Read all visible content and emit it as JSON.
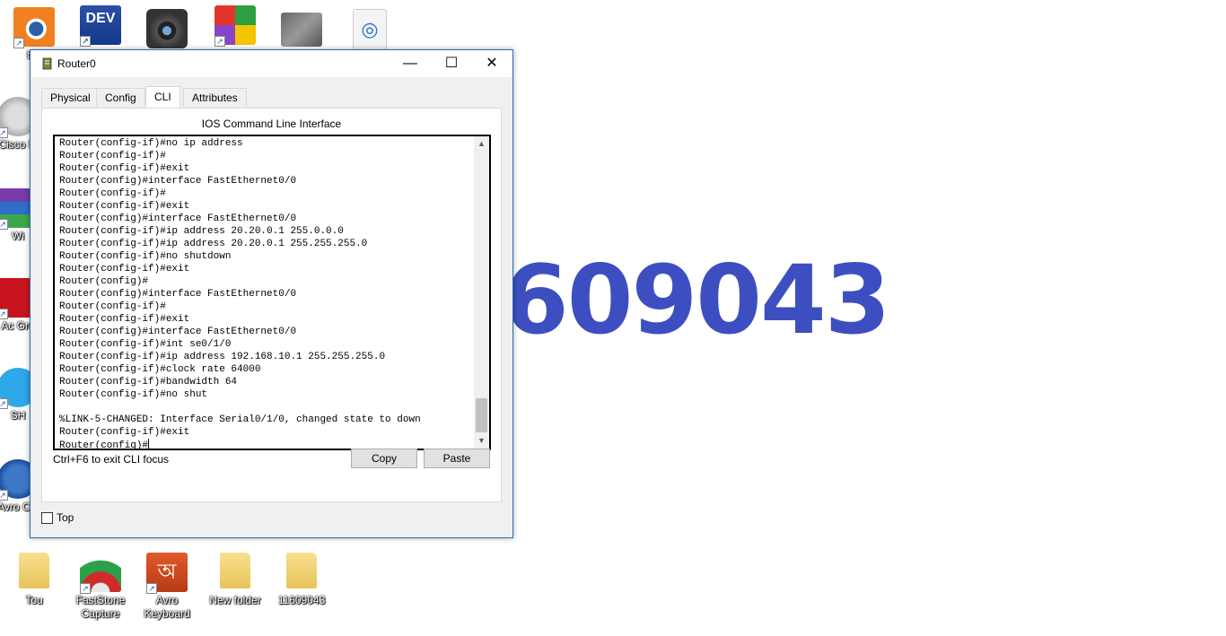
{
  "desktop": {
    "wallpaper_text": "609043",
    "icons": [
      {
        "label": "ble",
        "icon": "blender-icon"
      },
      {
        "label": "",
        "icon": "dev-cpp-icon",
        "badge": "DEV"
      },
      {
        "label": "",
        "icon": "camera-icon"
      },
      {
        "label": "",
        "icon": "windows-app-icon"
      },
      {
        "label": "",
        "icon": "photo-icon"
      },
      {
        "label": "",
        "icon": "document-icon"
      },
      {
        "label": "Cisco In",
        "icon": "cisco-icon"
      },
      {
        "label": "Wi",
        "icon": "winrar-icon"
      },
      {
        "label": "Ac Gre",
        "icon": "adobe-icon"
      },
      {
        "label": "SH",
        "icon": "shareit-icon"
      },
      {
        "label": "Avro Chi",
        "icon": "avro-icon"
      },
      {
        "label": "Tou",
        "icon": "folder-user-icon"
      },
      {
        "label": "FastStone Capture",
        "icon": "faststone-icon"
      },
      {
        "label": "Avro Keyboard",
        "icon": "avro-keyboard-icon",
        "badge": "অ"
      },
      {
        "label": "New folder",
        "icon": "folder-icon"
      },
      {
        "label": "11609043",
        "icon": "folder-icon"
      }
    ]
  },
  "window": {
    "title": "Router0",
    "controls": {
      "minimize": "—",
      "maximize": "☐",
      "close": "✕"
    },
    "tabs": [
      {
        "label": "Physical",
        "active": false
      },
      {
        "label": "Config",
        "active": false
      },
      {
        "label": "CLI",
        "active": true
      },
      {
        "label": "Attributes",
        "active": false
      }
    ],
    "panel_title": "IOS Command Line Interface",
    "terminal_lines": [
      "Router(config-if)#no ip address",
      "Router(config-if)#",
      "Router(config-if)#exit",
      "Router(config)#interface FastEthernet0/0",
      "Router(config-if)#",
      "Router(config-if)#exit",
      "Router(config)#interface FastEthernet0/0",
      "Router(config-if)#ip address 20.20.0.1 255.0.0.0",
      "Router(config-if)#ip address 20.20.0.1 255.255.255.0",
      "Router(config-if)#no shutdown",
      "Router(config-if)#exit",
      "Router(config)#",
      "Router(config)#interface FastEthernet0/0",
      "Router(config-if)#",
      "Router(config-if)#exit",
      "Router(config)#interface FastEthernet0/0",
      "Router(config-if)#int se0/1/0",
      "Router(config-if)#ip address 192.168.10.1 255.255.255.0",
      "Router(config-if)#clock rate 64000",
      "Router(config-if)#bandwidth 64",
      "Router(config-if)#no shut",
      "",
      "%LINK-5-CHANGED: Interface Serial0/1/0, changed state to down",
      "Router(config-if)#exit"
    ],
    "prompt": "Router(config)#",
    "hint": "Ctrl+F6 to exit CLI focus",
    "copy_label": "Copy",
    "paste_label": "Paste",
    "top_label": "Top",
    "top_checked": false
  }
}
